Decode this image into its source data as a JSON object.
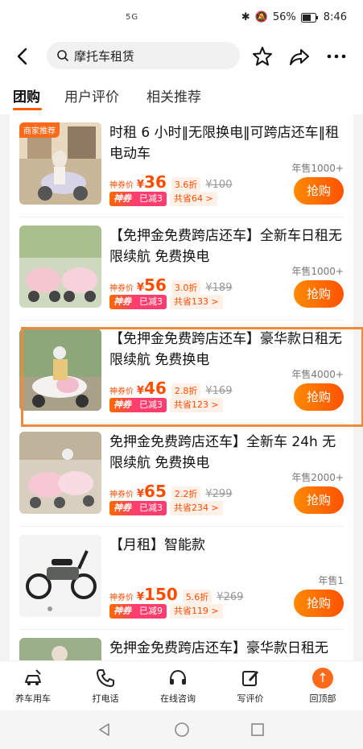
{
  "status": {
    "network": "5G",
    "battery": "56%",
    "time": "8:46"
  },
  "search": {
    "query": "摩托车租赁"
  },
  "tabs": [
    "团购",
    "用户评价",
    "相关推荐"
  ],
  "items": [
    {
      "tag": "商家推荐",
      "title": "时租 6 小时‖无限换电‖可跨店还车‖租电动车",
      "sold": "年售1000+",
      "price_label": "神券价",
      "yen": "¥",
      "price": "36",
      "discount": "3.6折",
      "original": "¥100",
      "shen": "神券",
      "jian": "已减3",
      "save": "共省64 >",
      "buy": "抢购"
    },
    {
      "tag": "",
      "title": "【免押金免费跨店还车】全新车日租无限续航 免费换电",
      "sold": "年售1000+",
      "price_label": "神券价",
      "yen": "¥",
      "price": "56",
      "discount": "3.0折",
      "original": "¥189",
      "shen": "神券",
      "jian": "已减3",
      "save": "共省133 >",
      "buy": "抢购"
    },
    {
      "tag": "",
      "title": "【免押金免费跨店还车】豪华款日租无限续航 免费换电",
      "sold": "年售4000+",
      "price_label": "神券价",
      "yen": "¥",
      "price": "46",
      "discount": "2.8折",
      "original": "¥169",
      "shen": "神券",
      "jian": "已减3",
      "save": "共省123 >",
      "buy": "抢购"
    },
    {
      "tag": "",
      "title": "免押金免费跨店还车】全新车 24h 无限续航 免费换电",
      "sold": "年售2000+",
      "price_label": "神券价",
      "yen": "¥",
      "price": "65",
      "discount": "2.2折",
      "original": "¥299",
      "shen": "神券",
      "jian": "已减3",
      "save": "共省234 >",
      "buy": "抢购"
    },
    {
      "tag": "",
      "title": "【月租】智能款",
      "sold": "年售1",
      "price_label": "神券价",
      "yen": "¥",
      "price": "150",
      "discount": "5.6折",
      "original": "¥269",
      "shen": "神券",
      "jian": "已减9",
      "save": "共省119 >",
      "buy": "抢购"
    },
    {
      "tag": "",
      "title": "免押金免费跨店还车】豪华款日租无",
      "sold": "",
      "price_label": "",
      "yen": "",
      "price": "",
      "discount": "",
      "original": "",
      "shen": "",
      "jian": "",
      "save": "",
      "buy": ""
    }
  ],
  "bottom_nav": [
    "养车用车",
    "打电话",
    "在线咨询",
    "写评价",
    "回顶部"
  ],
  "colors": {
    "accent": "#ff5a00",
    "highlight": "#f08a3a"
  }
}
